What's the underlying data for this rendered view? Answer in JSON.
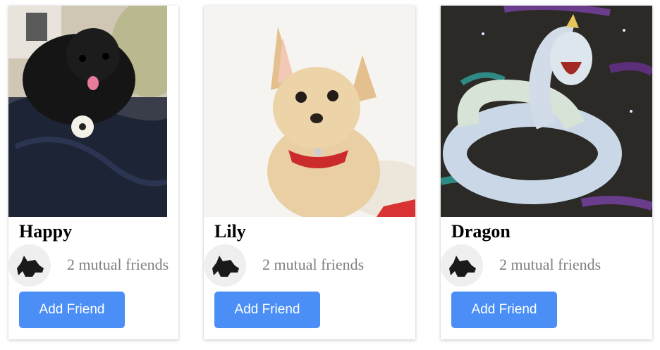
{
  "cards": [
    {
      "name": "Happy",
      "mutual_friends": "2 mutual friends",
      "button_label": "Add Friend",
      "photo": "black-poodle-photo"
    },
    {
      "name": "Lily",
      "mutual_friends": "2 mutual friends",
      "button_label": "Add Friend",
      "photo": "chihuahua-photo"
    },
    {
      "name": "Dragon",
      "mutual_friends": "2 mutual friends",
      "button_label": "Add Friend",
      "photo": "dragon-illustration"
    }
  ],
  "avatar_icon": "dog-head-icon",
  "colors": {
    "button": "#4b8ff6",
    "button_text": "#ffffff",
    "muted_text": "#808080"
  }
}
